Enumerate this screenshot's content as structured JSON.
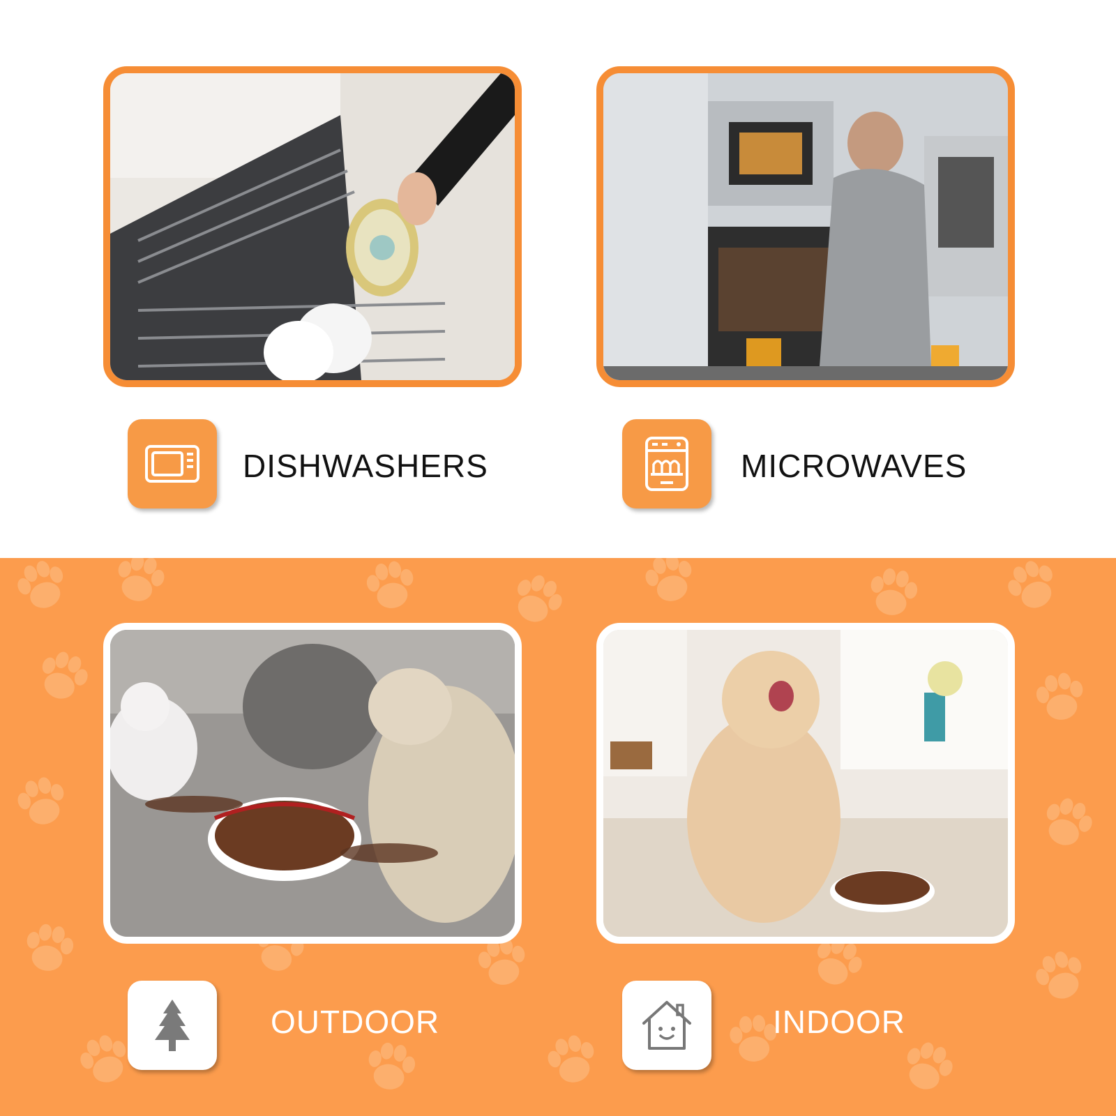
{
  "colors": {
    "accent_orange": "#f68d35",
    "tile_orange": "#f79a46",
    "background_orange": "#fc9c4d",
    "paw_print": "#fdb678",
    "text_dark": "#111111",
    "text_light": "#ffffff",
    "icon_gray": "#777777"
  },
  "features": {
    "dishwashers": {
      "label": "DISHWASHERS",
      "icon": "microwave-icon"
    },
    "microwaves": {
      "label": "MICROWAVES",
      "icon": "dishwasher-icon"
    },
    "outdoor": {
      "label": "OUTDOOR",
      "icon": "pine-tree-icon"
    },
    "indoor": {
      "label": "INDOOR",
      "icon": "house-smile-icon"
    }
  }
}
